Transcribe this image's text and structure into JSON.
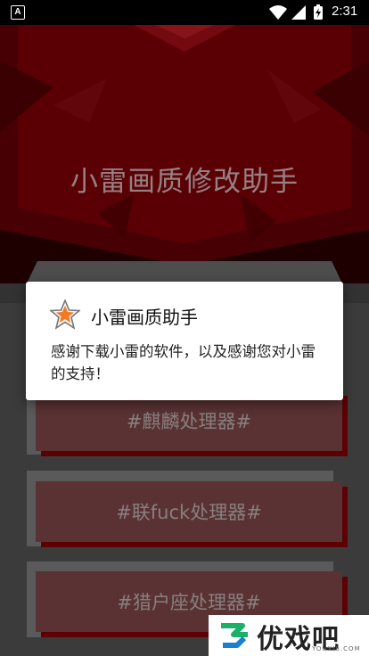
{
  "status_bar": {
    "left_icon": "A",
    "time": "2:31",
    "icons": [
      "wifi-icon",
      "cell-signal-icon",
      "battery-charging-icon"
    ]
  },
  "header": {
    "title": "小雷画质修改助手",
    "accent": "#8b0005"
  },
  "items": [
    {
      "label": "#麒麟处理器#"
    },
    {
      "label": "#联fuck处理器#"
    },
    {
      "label": "#猎户座处理器#"
    }
  ],
  "dialog": {
    "icon": "star-icon",
    "title": "小雷画质助手",
    "message": "感谢下载小雷的软件，以及感谢您对小雷的支持！"
  },
  "watermark": {
    "text": "优戏吧",
    "sub": "YOUXI8.COM"
  }
}
